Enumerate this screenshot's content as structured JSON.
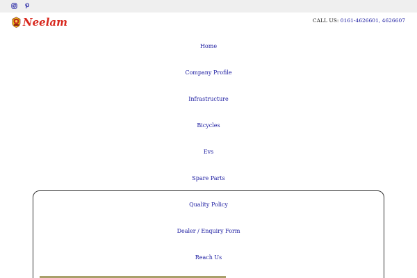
{
  "topbar": {
    "social": [
      {
        "icon": "instagram-icon"
      },
      {
        "icon": "pinterest-icon"
      }
    ]
  },
  "header": {
    "logo_text": "Neelam",
    "call_label": "CALL US:",
    "call_numbers": "0161-4626601, 4626607"
  },
  "nav": {
    "items": [
      {
        "label": "Home"
      },
      {
        "label": "Company Profile"
      },
      {
        "label": "Infrastructure"
      },
      {
        "label": "Bicycles"
      },
      {
        "label": "Evs"
      },
      {
        "label": "Spare Parts"
      },
      {
        "label": "Quality Policy"
      },
      {
        "label": "Dealer / Enquiry Form"
      },
      {
        "label": "Reach Us"
      }
    ]
  },
  "colors": {
    "link": "#1a1aa0",
    "brand_red": "#d8281e",
    "topbar_bg": "#efefef"
  }
}
